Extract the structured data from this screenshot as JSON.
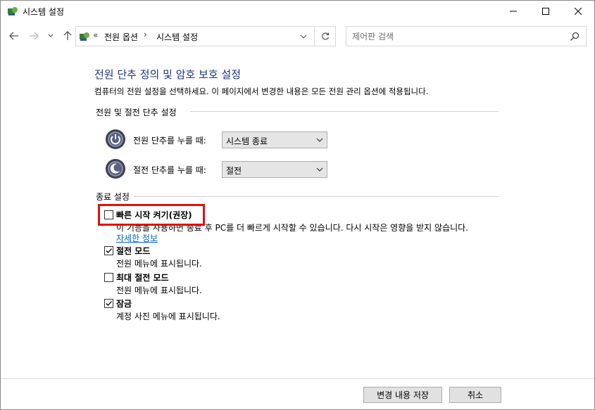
{
  "window": {
    "title": "시스템 설정",
    "minimize": "minimize",
    "maximize": "maximize",
    "close": "close"
  },
  "nav": {
    "address_prefix": "«",
    "breadcrumbs": [
      "전원 옵션",
      "시스템 설정"
    ],
    "separator": "›",
    "search_placeholder": "제어판 검색"
  },
  "main": {
    "title": "전원 단추 정의 및 암호 보호 설정",
    "description": "컴퓨터의 전원 설정을 선택하세요. 이 페이지에서 변경한 내용은 모든 전원 관리 옵션에 적용됩니다.",
    "power_group": {
      "title": "전원 및 절전 단추 설정",
      "rows": [
        {
          "label": "전원 단추를 누를 때:",
          "value": "시스템 종료"
        },
        {
          "label": "절전 단추를 누를 때:",
          "value": "절전"
        }
      ]
    },
    "shutdown_group": {
      "title": "종료 설정",
      "fast_startup": {
        "label": "빠른 시작 켜기(권장)",
        "checked": false,
        "description": "이 기능을 사용하면 종료 후 PC를 더 빠르게 시작할 수 있습니다. 다시 시작은 영향을 받지 않습니다.",
        "link": "자세한 정보"
      },
      "options": [
        {
          "label": "절전 모드",
          "checked": true,
          "description": "전원 메뉴에 표시됩니다."
        },
        {
          "label": "최대 절전 모드",
          "checked": false,
          "description": "전원 메뉴에 표시됩니다."
        },
        {
          "label": "잠금",
          "checked": true,
          "description": "계정 사진 메뉴에 표시됩니다."
        }
      ]
    }
  },
  "footer": {
    "save_label": "변경 내용 저장",
    "cancel_label": "취소"
  },
  "colors": {
    "title_blue": "#1e3287",
    "link_blue": "#0066cc",
    "highlight_red": "#e01010"
  }
}
